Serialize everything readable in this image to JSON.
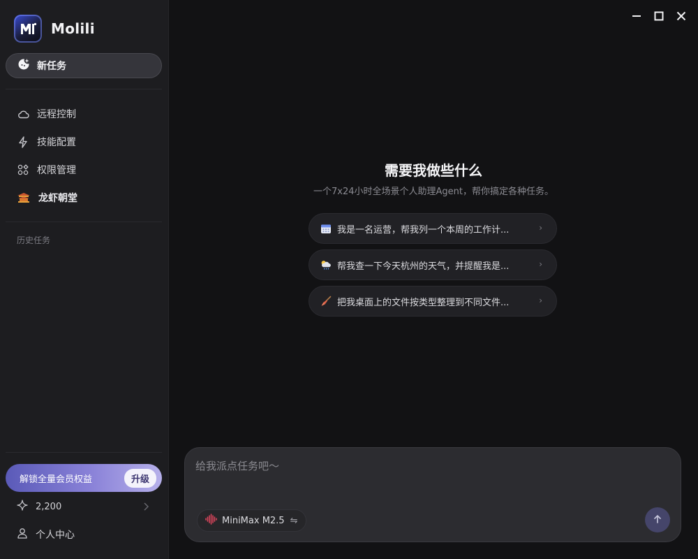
{
  "app": {
    "name": "Molili"
  },
  "sidebar": {
    "new_task": {
      "label": "新任务",
      "icon": "new-task-icon"
    },
    "nav": [
      {
        "label": "远程控制",
        "icon": "cloud-icon"
      },
      {
        "label": "技能配置",
        "icon": "lightning-icon"
      },
      {
        "label": "权限管理",
        "icon": "grid-icon"
      },
      {
        "label": "龙虾朝堂",
        "icon": "palace-icon"
      }
    ],
    "history_title": "历史任务",
    "upgrade": {
      "label": "解锁全量会员权益",
      "button": "升级"
    },
    "points": {
      "value": "2,200",
      "icon": "sparkle-icon"
    },
    "profile": {
      "label": "个人中心",
      "icon": "user-icon"
    }
  },
  "window_controls": [
    "minimize",
    "maximize",
    "close"
  ],
  "main": {
    "title": "需要我做些什么",
    "subtitle": "一个7x24小时全场景个人助理Agent，帮你搞定各种任务。",
    "suggestions": [
      {
        "icon": "calendar-icon",
        "text": "我是一名运营，帮我列一个本周的工作计..."
      },
      {
        "icon": "weather-icon",
        "text": "帮我查一下今天杭州的天气，并提醒我是..."
      },
      {
        "icon": "broom-icon",
        "text": "把我桌面上的文件按类型整理到不同文件..."
      }
    ]
  },
  "composer": {
    "placeholder": "给我派点任务吧〜",
    "value": "",
    "model": "MiniMax M2.5",
    "swap_glyph": "⇋"
  },
  "colors": {
    "background": "#121214",
    "sidebar": "#1d1d20",
    "accent": "#45456a",
    "upgrade_start": "#5a5ab8",
    "upgrade_end": "#b6b0ea"
  }
}
